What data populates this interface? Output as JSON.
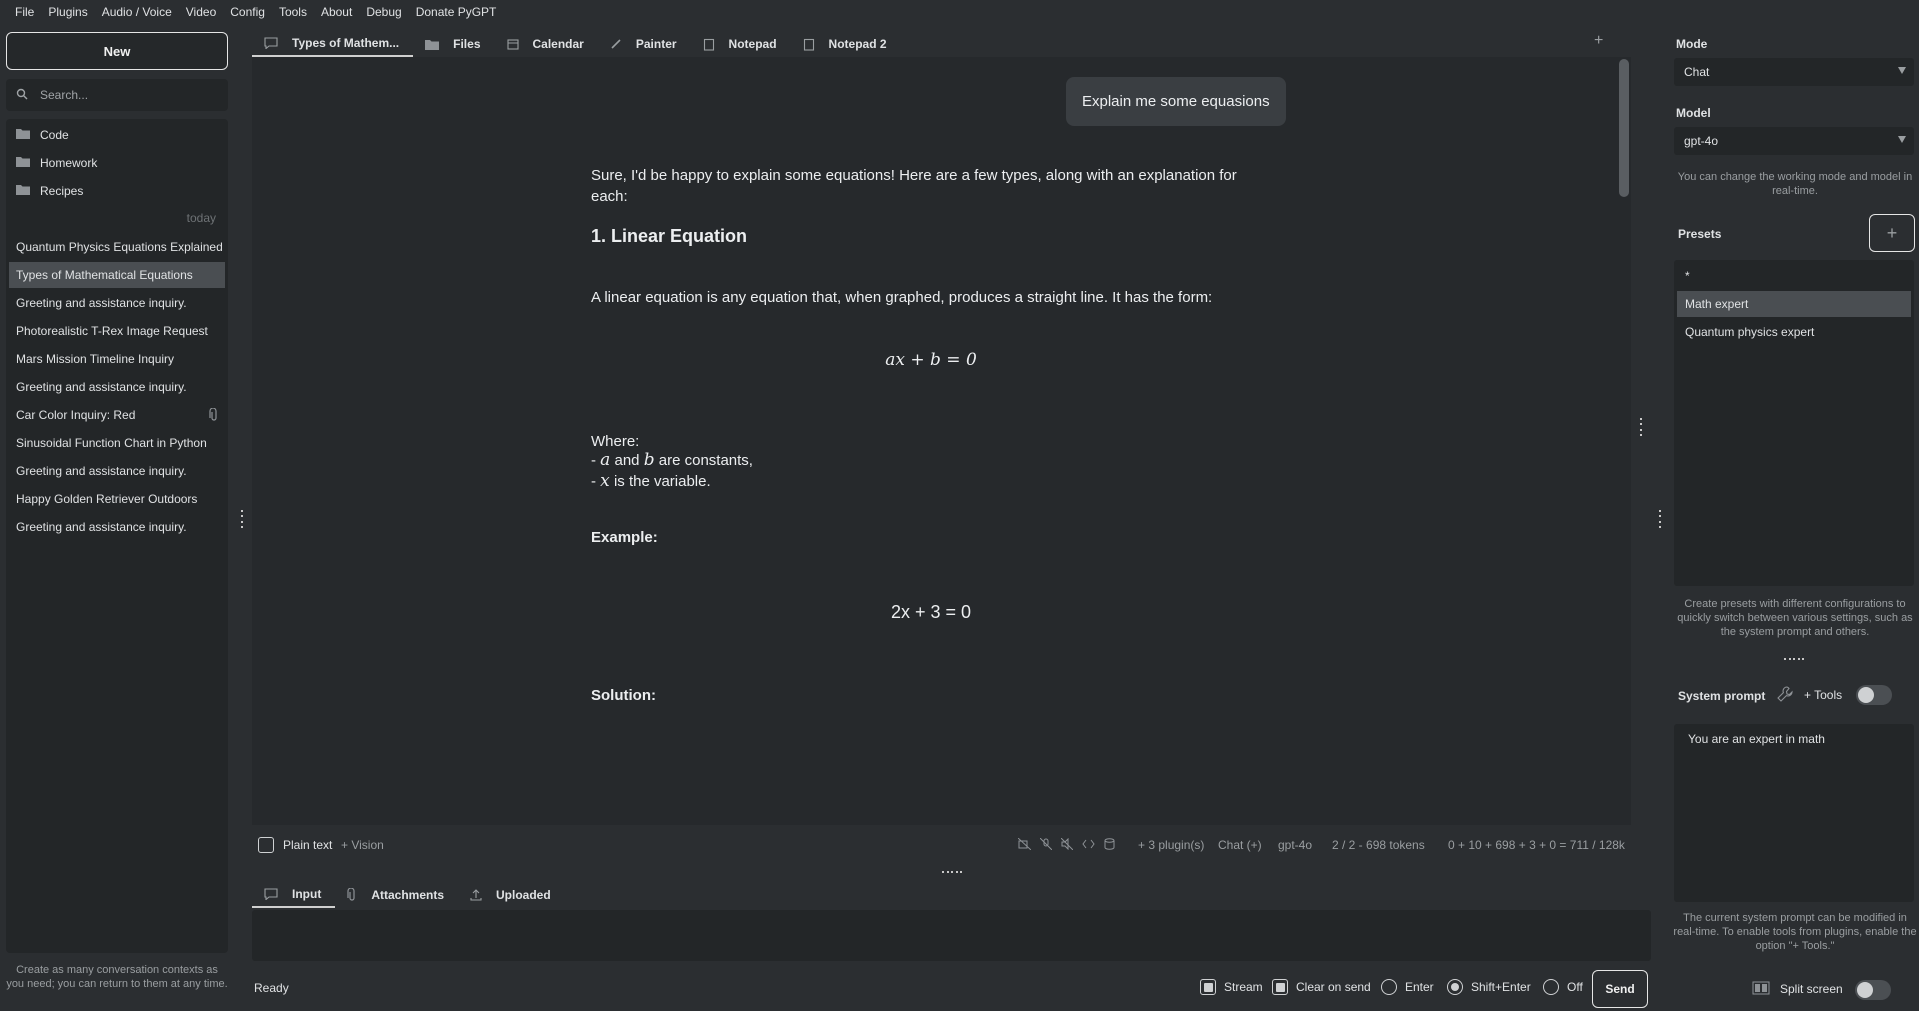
{
  "menu": [
    "File",
    "Plugins",
    "Audio / Voice",
    "Video",
    "Config",
    "Tools",
    "About",
    "Debug",
    "Donate PyGPT"
  ],
  "sidebar": {
    "new_label": "New",
    "search_placeholder": "Search...",
    "folders": [
      "Code",
      "Homework",
      "Recipes"
    ],
    "group_label": "today",
    "items": [
      "Quantum Physics Equations Explained",
      "Types of Mathematical Equations",
      "Greeting and assistance inquiry.",
      "Photorealistic T-Rex Image Request",
      "Mars Mission Timeline Inquiry",
      "Greeting and assistance inquiry.",
      "Car Color Inquiry: Red",
      "Sinusoidal Function Chart in Python",
      "Greeting and assistance inquiry.",
      "Happy Golden Retriever Outdoors",
      "Greeting and assistance inquiry."
    ],
    "hint": "Create as many conversation contexts as you need; you can return to them at any time."
  },
  "tabs": [
    "Types of Mathem...",
    "Files",
    "Calendar",
    "Painter",
    "Notepad",
    "Notepad 2"
  ],
  "chat": {
    "user_message": "Explain me some equasions",
    "intro": "Sure, I'd be happy to explain some equations! Here are a few types, along with an explanation for each:",
    "heading": "1. Linear Equation",
    "desc": "A linear equation is any equation that, when graphed, produces a straight line. It has the form:",
    "equation1": "ax + b = 0",
    "where": "Where:",
    "where1_a": "a",
    "where1_and": "and",
    "where1_b": "b",
    "where1_rest": "are constants,",
    "where2_x": "x",
    "where2_rest": "is the variable.",
    "example": "Example:",
    "equation2": "2x + 3 = 0",
    "solution": "Solution:"
  },
  "status": {
    "plain_text": "Plain text",
    "vision": "+ Vision",
    "plugins": "+ 3 plugin(s)",
    "mode": "Chat (+)",
    "model": "gpt-4o",
    "tokens": "2 / 2 - 698 tokens",
    "usage": "0 + 10 + 698 + 3 + 0 = 711 / 128k"
  },
  "input_tabs": [
    "Input",
    "Attachments",
    "Uploaded"
  ],
  "bottom": {
    "ready": "Ready",
    "stream": "Stream",
    "clear_on_send": "Clear on send",
    "enter": "Enter",
    "shift_enter": "Shift+Enter",
    "off": "Off",
    "send": "Send"
  },
  "right": {
    "mode_label": "Mode",
    "mode_value": "Chat",
    "model_label": "Model",
    "model_value": "gpt-4o",
    "mode_hint": "You can change the working mode and model in real-time.",
    "presets_label": "Presets",
    "presets": [
      "*",
      "Math expert",
      "Quantum physics expert"
    ],
    "presets_hint": "Create presets with different configurations to quickly switch between various settings, such as the system prompt and others.",
    "system_prompt_label": "System prompt",
    "tools_label": "+ Tools",
    "system_prompt": "You are an expert in math",
    "system_hint": "The current system prompt can be modified in real-time. To enable tools from plugins, enable the option \"+ Tools.\"",
    "split_screen": "Split screen"
  }
}
